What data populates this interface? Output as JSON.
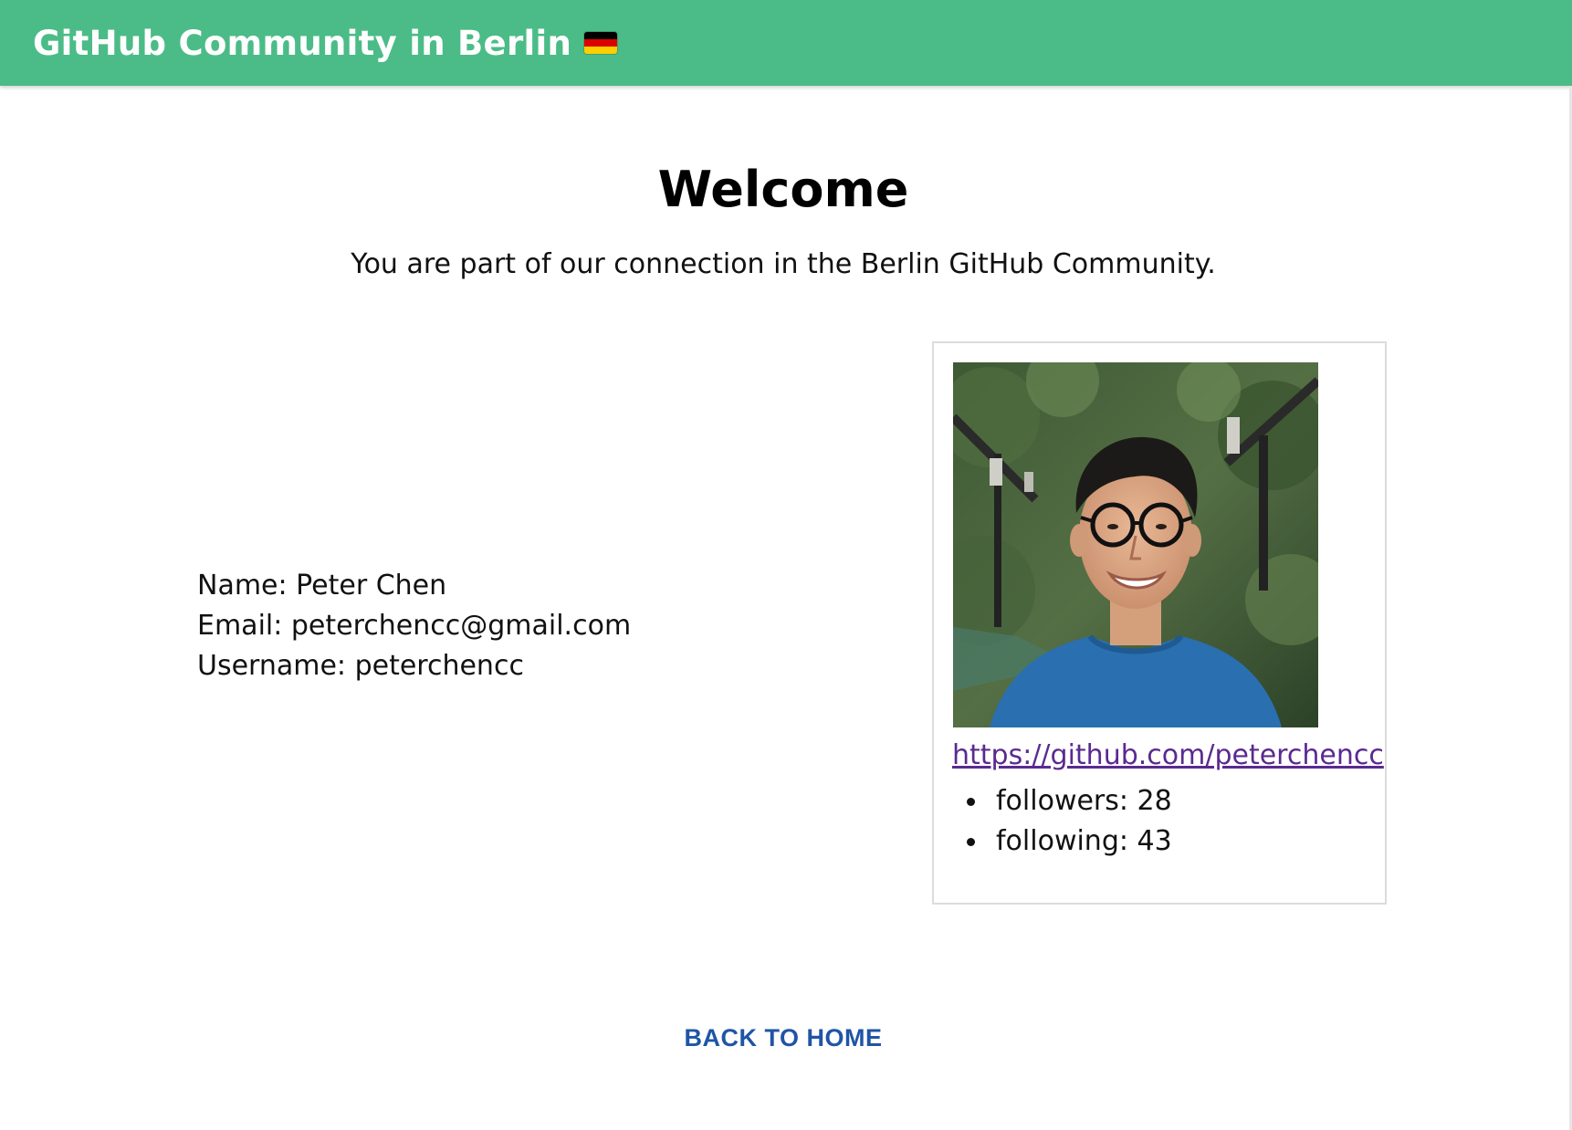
{
  "header": {
    "title": "GitHub Community in Berlin",
    "flag_icon": "german-flag-icon",
    "background_color": "#4bbc87"
  },
  "main": {
    "heading": "Welcome",
    "subtitle": "You are part of our connection in the Berlin GitHub Community."
  },
  "user": {
    "name_line": "Name: Peter Chen",
    "email_line": "Email: peterchencc@gmail.com",
    "username_line": "Username: peterchencc"
  },
  "profile_card": {
    "avatar": "user-avatar-photo",
    "link": "https://github.com/peterchencc",
    "stats": [
      "followers: 28",
      "following: 43"
    ]
  },
  "footer": {
    "back_label": "BACK TO HOME",
    "link_color": "#1f55a6"
  }
}
